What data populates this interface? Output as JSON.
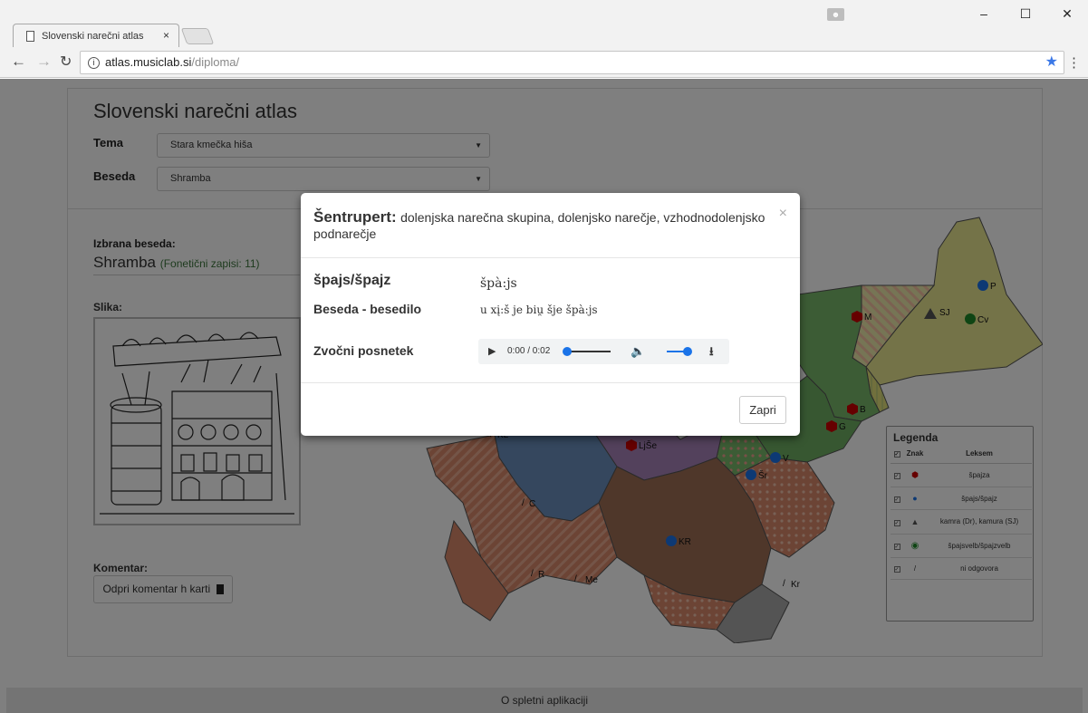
{
  "browser": {
    "tab_title": "Slovenski narečni atlas",
    "tab_close": "×",
    "url_host": "atlas.musiclab.si",
    "url_path": "/diploma/",
    "win_min": "–",
    "win_max": "☐",
    "win_close": "✕"
  },
  "app": {
    "title": "Slovenski narečni atlas",
    "tema_label": "Tema",
    "tema_value": "Stara kmečka hiša",
    "beseda_label": "Beseda",
    "beseda_value": "Shramba",
    "izbrana_label": "Izbrana beseda:",
    "izbrana_value": "Shramba",
    "foneticni": "(Fonetični zapisi: 11)",
    "slika_label": "Slika:",
    "komentar_label": "Komentar:",
    "komentar_button": "Odpri komentar h karti",
    "footer": "O spletni aplikaciji"
  },
  "map": {
    "labels": [
      "P",
      "M",
      "SJ",
      "Cv",
      "B",
      "G",
      "V",
      "Šr",
      "LjŠe",
      "KL",
      "C",
      "KR",
      "R",
      "Me",
      "Kr"
    ]
  },
  "legend": {
    "title": "Legenda",
    "col_znak": "Znak",
    "col_leksem": "Leksem",
    "rows": [
      {
        "leksem": "špajza",
        "symbol": "red-hexagon"
      },
      {
        "leksem": "špajs/špajz",
        "symbol": "blue-circle"
      },
      {
        "leksem": "kamra (Dr), kamura (SJ)",
        "symbol": "gray-triangle"
      },
      {
        "leksem": "špajsvelb/špajzvelb",
        "symbol": "green-circle"
      },
      {
        "leksem": "ni odgovora",
        "symbol": "slash"
      }
    ]
  },
  "modal": {
    "place": "Šentrupert:",
    "description": "dolenjska narečna skupina, dolenjsko narečje, vzhodnodolenjsko podnarečje",
    "close": "×",
    "word_label": "špajs/špajz",
    "word_value": "špà:js",
    "context_label": "Beseda - besedilo",
    "context_value": "u xį:š je biu̯ šje špà:js",
    "audio_label": "Zvočni posnetek",
    "audio_time": "0:00 / 0:02",
    "zapri": "Zapri"
  },
  "colors": {
    "overlay": "rgba(0,0,0,0.5)",
    "accent_blue": "#1a73e8",
    "count_green": "#3c763d"
  }
}
